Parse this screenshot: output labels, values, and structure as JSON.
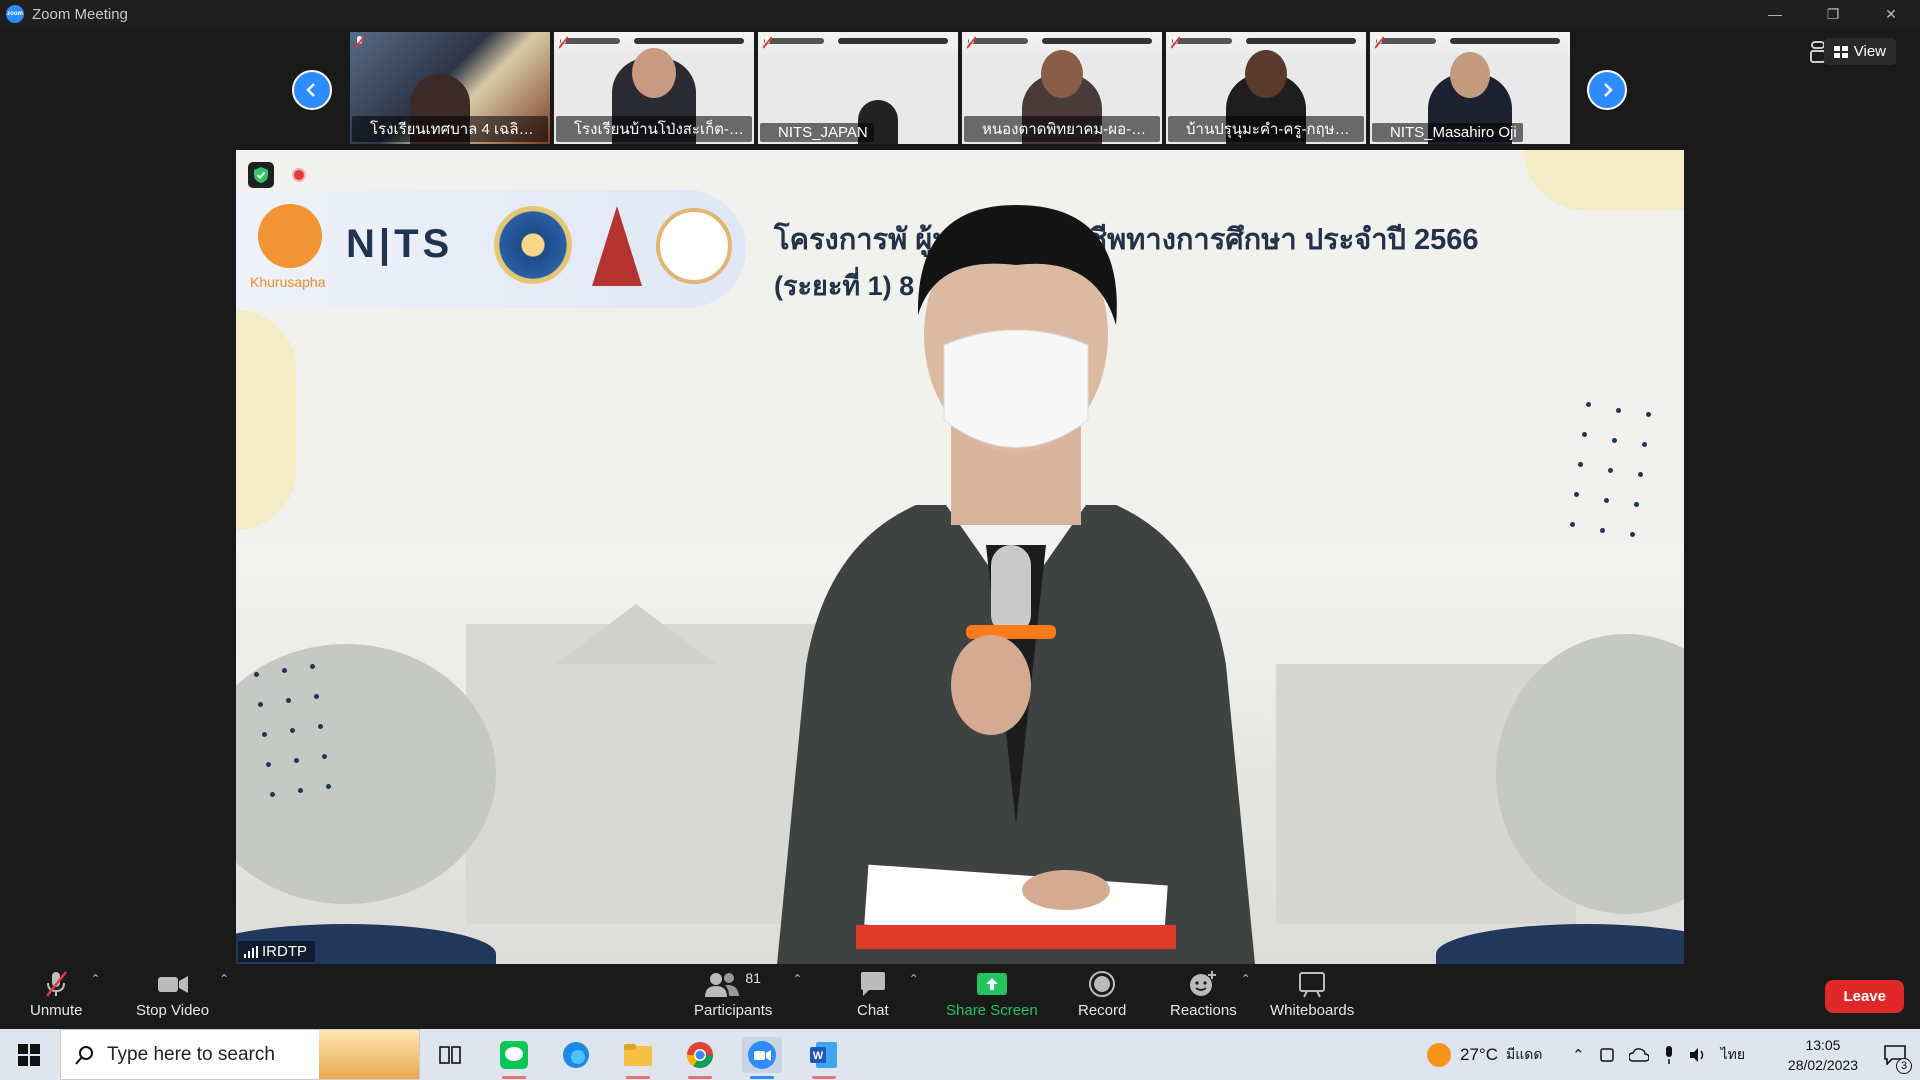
{
  "window": {
    "title": "Zoom Meeting"
  },
  "strip": {
    "participants": [
      {
        "name": "โรงเรียนเทศบาล 4 เฉลิมพ..."
      },
      {
        "name": "โรงเรียนบ้านโป่งสะเก็ต-ครู-..."
      },
      {
        "name": "NITS_JAPAN"
      },
      {
        "name": "หนองตาดพิทยาคม-ผอ-น้ำ..."
      },
      {
        "name": "บ้านปรุนุมะคำ-ครู-กฤษณา..."
      },
      {
        "name": "NITS_Masahiro Oji"
      }
    ],
    "view_label": "View"
  },
  "main": {
    "speaker_name": "IRDTP",
    "slide_title_line1": "โครงการพั    ผู้ประกอบวิชาชีพทางการศึกษา ประจำปี 2566",
    "slide_title_line2": "(ระยะที่ 1)        8 กุมภาพันธ์ 2566",
    "logo_khurusapha": "Khurusapha",
    "logo_nits": "N|TS"
  },
  "toolbar": {
    "unmute": "Unmute",
    "stop_video": "Stop Video",
    "participants": "Participants",
    "participant_count": "81",
    "chat": "Chat",
    "share_screen": "Share Screen",
    "record": "Record",
    "reactions": "Reactions",
    "whiteboards": "Whiteboards",
    "leave": "Leave"
  },
  "taskbar": {
    "search_placeholder": "Type here to search",
    "weather": "27°C",
    "weather_desc": "มีแดด",
    "lang": "ไทย",
    "time": "13:05",
    "date": "28/02/2023",
    "notifications": "3"
  },
  "colors": {
    "accent": "#2d8cff",
    "leave": "#e02828",
    "share": "#22c55e"
  }
}
